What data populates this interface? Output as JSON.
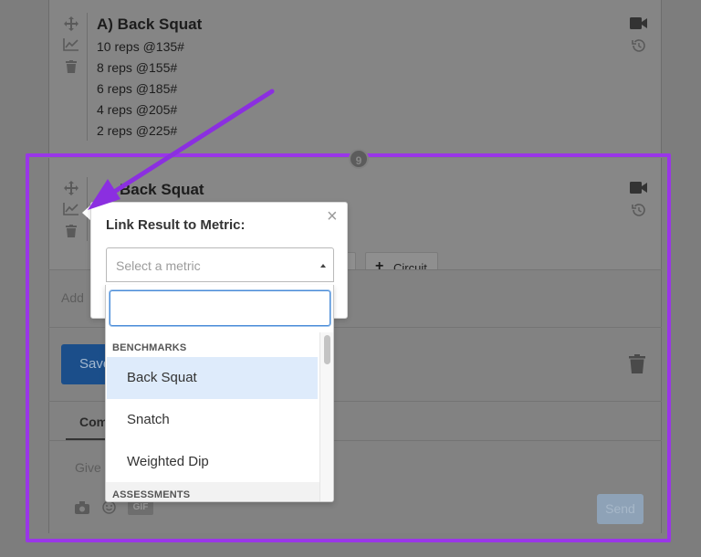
{
  "top_card": {
    "title": "A)  Back Squat",
    "reps": [
      "10 reps @135#",
      "8 reps @155#",
      "6 reps @185#",
      "4 reps @205#",
      "2 reps @225#"
    ]
  },
  "badge": "9",
  "second_card": {
    "title": "Back Squat",
    "circuit_label": "Circuit",
    "plus": "+"
  },
  "add_text": "Add",
  "save_label": "Save",
  "comments_tab": "Comments",
  "give_text": "Give",
  "gif_label": "GIF",
  "send_label": "Send",
  "popover": {
    "title": "Link Result to Metric:",
    "close": "×",
    "select_placeholder": "Select a metric"
  },
  "dropdown": {
    "search_value": "",
    "groups": [
      {
        "label": "BENCHMARKS",
        "options": [
          "Back Squat",
          "Snatch",
          "Weighted Dip"
        ]
      },
      {
        "label": "ASSESSMENTS",
        "options": []
      }
    ],
    "active_option": "Back Squat"
  },
  "colors": {
    "highlight": "#9a36e8",
    "arrow": "#8b2fe0",
    "primary": "#1b4e8a",
    "focus": "#4b8cd8"
  }
}
